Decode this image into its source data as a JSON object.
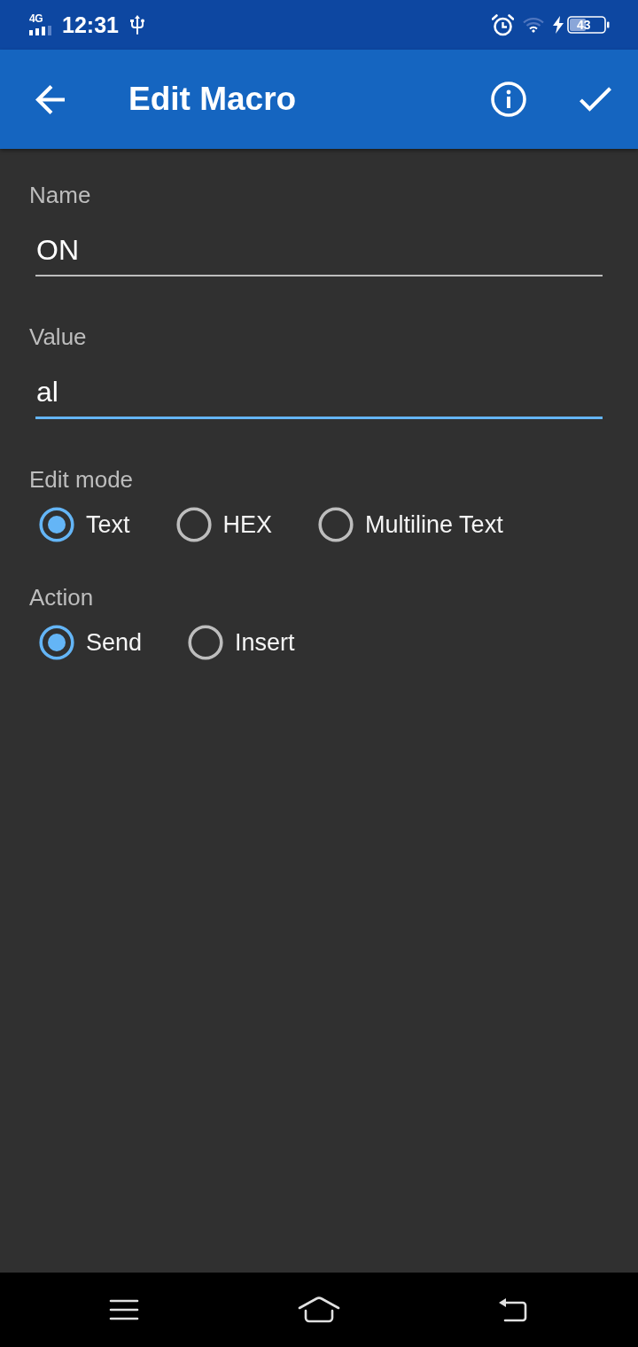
{
  "status_bar": {
    "network": "4G",
    "time": "12:31",
    "battery": "43"
  },
  "app_bar": {
    "title": "Edit Macro"
  },
  "fields": [
    {
      "label": "Name",
      "value": "ON",
      "focused": false
    },
    {
      "label": "Value",
      "value": "al",
      "focused": true
    }
  ],
  "radio_groups": [
    {
      "label": "Edit mode",
      "options": [
        {
          "label": "Text",
          "selected": true
        },
        {
          "label": "HEX",
          "selected": false
        },
        {
          "label": "Multiline Text",
          "selected": false
        }
      ]
    },
    {
      "label": "Action",
      "options": [
        {
          "label": "Send",
          "selected": true
        },
        {
          "label": "Insert",
          "selected": false
        }
      ]
    }
  ]
}
